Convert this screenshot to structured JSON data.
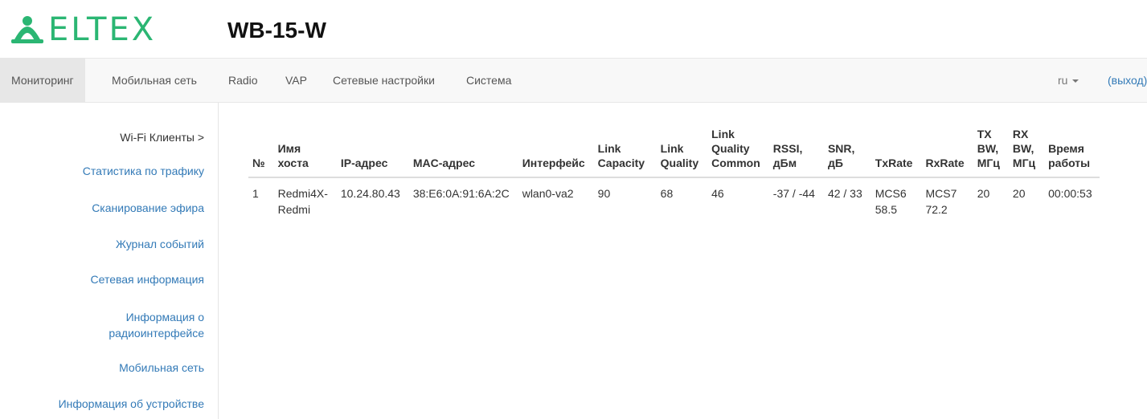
{
  "brand": {
    "logo_text": "ELTEX",
    "model": "WB-15-W",
    "brand_color": "#2bb673"
  },
  "nav": {
    "items": [
      "Мониторинг",
      "Мобильная сеть",
      "Radio",
      "VAP",
      "Сетевые настройки",
      "Система"
    ],
    "active": "Мониторинг",
    "lang": "ru",
    "logout": "(выход)"
  },
  "sidebar": {
    "items": [
      {
        "label": "Wi-Fi Клиенты >",
        "active": true
      },
      {
        "label": "Статистика по трафику"
      },
      {
        "label": "Сканирование эфира"
      },
      {
        "label": "Журнал событий"
      },
      {
        "label": "Сетевая информация"
      },
      {
        "label": "Информация о радиоинтерфейсе"
      },
      {
        "label": "Мобильная сеть"
      },
      {
        "label": "Информация об устройстве"
      }
    ]
  },
  "table": {
    "headers": [
      "№",
      "Имя хоста",
      "IP-адрес",
      "MAC-адрес",
      "Интерфейс",
      "Link Capacity",
      "Link Quality",
      "Link Quality Common",
      "RSSI, дБм",
      "SNR, дБ",
      "TxRate",
      "RxRate",
      "TX BW, МГц",
      "RX BW, МГц",
      "Время работы"
    ],
    "rows": [
      [
        "1",
        "Redmi4X-Redmi",
        "10.24.80.43",
        "38:E6:0A:91:6A:2C",
        "wlan0-va2",
        "90",
        "68",
        "46",
        "-37 / -44",
        "42 / 33",
        "MCS6 58.5",
        "MCS7 72.2",
        "20",
        "20",
        "00:00:53"
      ]
    ]
  }
}
